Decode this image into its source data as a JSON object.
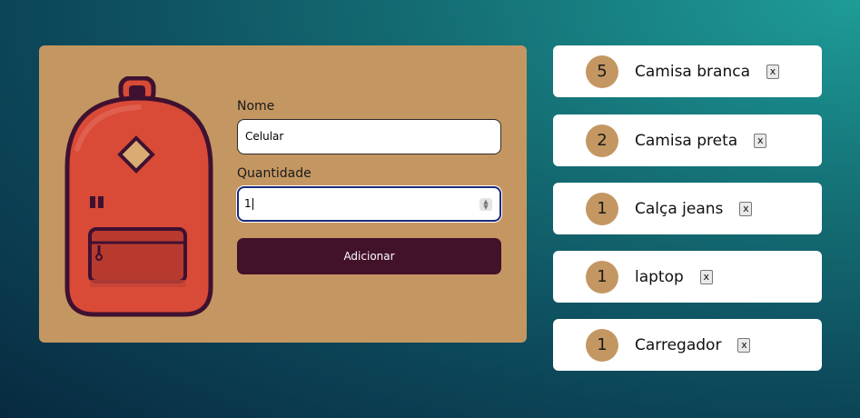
{
  "form": {
    "name_label": "Nome",
    "name_value": "Celular",
    "quantity_label": "Quantidade",
    "quantity_value": "1",
    "submit_label": "Adicionar"
  },
  "items": [
    {
      "quantity": "5",
      "name": "Camisa branca",
      "remove_label": "x"
    },
    {
      "quantity": "2",
      "name": "Camisa preta",
      "remove_label": "x"
    },
    {
      "quantity": "1",
      "name": "Calça jeans",
      "remove_label": "x"
    },
    {
      "quantity": "1",
      "name": "laptop",
      "remove_label": "x"
    },
    {
      "quantity": "1",
      "name": "Carregador",
      "remove_label": "x"
    }
  ],
  "colors": {
    "card": "#c49762",
    "button": "#42112a",
    "backpack_body": "#d94a37",
    "backpack_outline": "#3f1130"
  },
  "icons": {
    "illustration": "backpack-illustration",
    "spinner": "number-spinner-icon"
  }
}
